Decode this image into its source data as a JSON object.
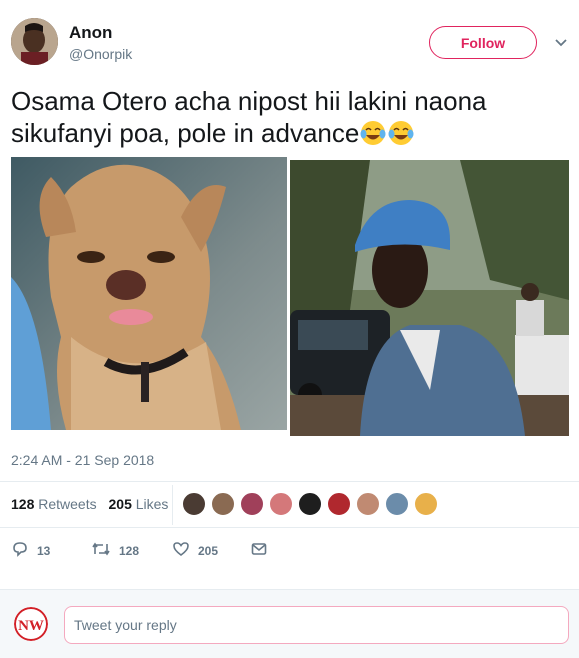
{
  "author": {
    "name": "Anon",
    "handle": "@Onorpik"
  },
  "follow_label": "Follow",
  "tweet": {
    "text": "Osama Otero acha nipost hii lakini naona sikufanyi poa, pole in advance",
    "emojis": [
      "😂",
      "😂"
    ]
  },
  "timestamp": "2:24 AM - 21 Sep 2018",
  "stats": {
    "retweets_count": "128",
    "retweets_label": "Retweets",
    "likes_count": "205",
    "likes_label": "Likes"
  },
  "likers_avatar_count_shown": 9,
  "actions": {
    "replies": "13",
    "retweets": "128",
    "likes": "205"
  },
  "reply": {
    "placeholder": "Tweet your reply",
    "logo_text": "NW"
  },
  "colors": {
    "follow_accent": "#e0245e",
    "muted_text": "#657786",
    "divider": "#e6ecf0",
    "reply_bg": "#f5f8fa"
  },
  "icons": {
    "caret": "chevron-down-icon",
    "reply": "reply-icon",
    "retweet": "retweet-icon",
    "like": "heart-icon",
    "dm": "envelope-icon"
  }
}
